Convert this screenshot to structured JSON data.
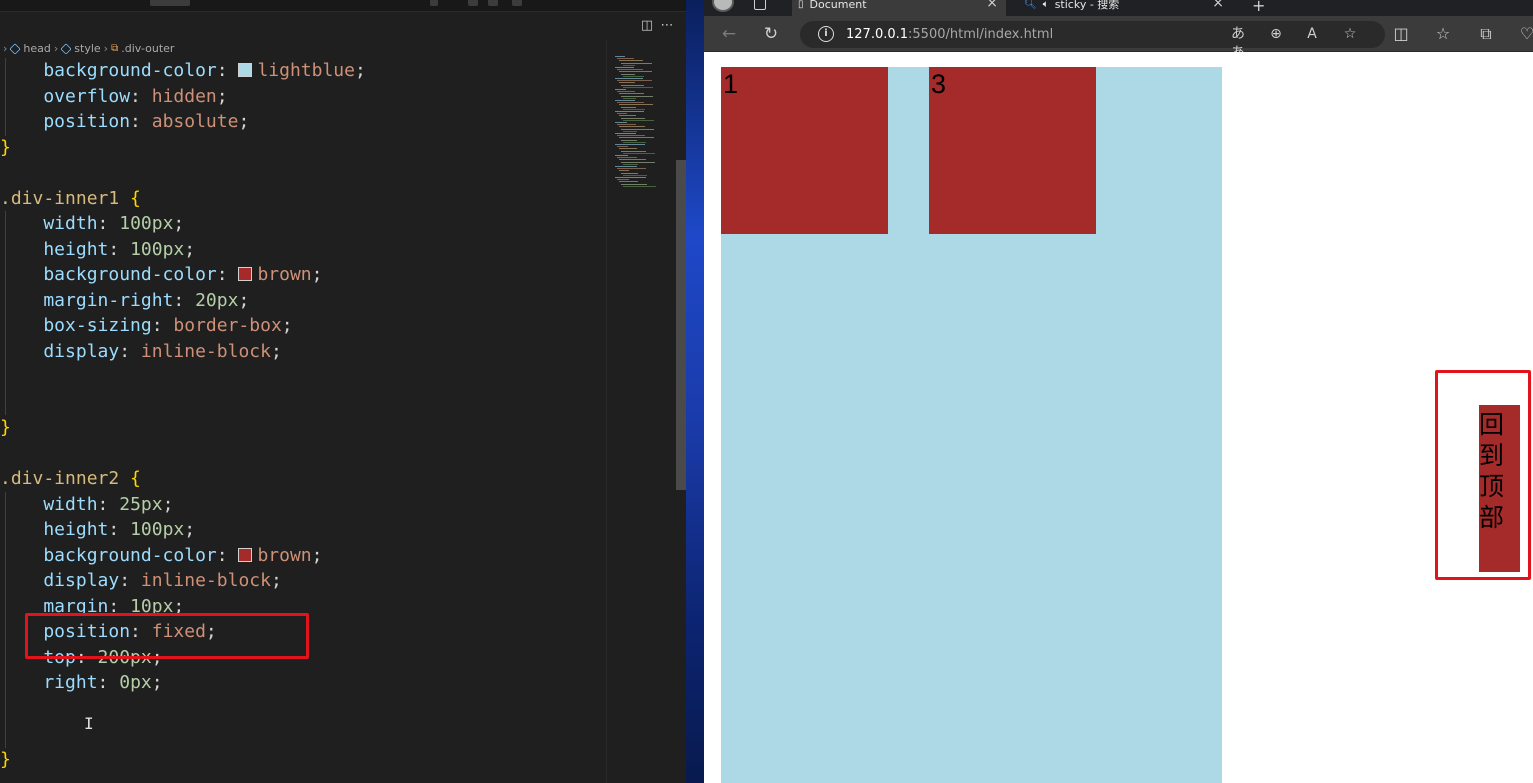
{
  "editor": {
    "breadcrumb": [
      "head",
      "style",
      ".div-outer"
    ],
    "lines": [
      {
        "row": 0,
        "tokens": [
          {
            "c": "prop",
            "t": "    background-color"
          },
          {
            "c": "punc",
            "t": ": "
          },
          {
            "c": "swatch",
            "color": "#add8e6"
          },
          {
            "c": "val",
            "t": "lightblue"
          },
          {
            "c": "punc",
            "t": ";"
          }
        ]
      },
      {
        "row": 1,
        "tokens": [
          {
            "c": "prop",
            "t": "    overflow"
          },
          {
            "c": "punc",
            "t": ": "
          },
          {
            "c": "val",
            "t": "hidden"
          },
          {
            "c": "punc",
            "t": ";"
          }
        ]
      },
      {
        "row": 2,
        "tokens": [
          {
            "c": "prop",
            "t": "    position"
          },
          {
            "c": "punc",
            "t": ": "
          },
          {
            "c": "val",
            "t": "absolute"
          },
          {
            "c": "punc",
            "t": ";"
          }
        ]
      },
      {
        "row": 3,
        "tokens": [
          {
            "c": "brace",
            "t": "}"
          }
        ]
      },
      {
        "row": 4,
        "tokens": []
      },
      {
        "row": 5,
        "tokens": [
          {
            "c": "sel",
            "t": ".div-inner1 "
          },
          {
            "c": "brace",
            "t": "{"
          }
        ]
      },
      {
        "row": 6,
        "tokens": [
          {
            "c": "prop",
            "t": "    width"
          },
          {
            "c": "punc",
            "t": ": "
          },
          {
            "c": "num",
            "t": "100px"
          },
          {
            "c": "punc",
            "t": ";"
          }
        ]
      },
      {
        "row": 7,
        "tokens": [
          {
            "c": "prop",
            "t": "    height"
          },
          {
            "c": "punc",
            "t": ": "
          },
          {
            "c": "num",
            "t": "100px"
          },
          {
            "c": "punc",
            "t": ";"
          }
        ]
      },
      {
        "row": 8,
        "tokens": [
          {
            "c": "prop",
            "t": "    background-color"
          },
          {
            "c": "punc",
            "t": ": "
          },
          {
            "c": "swatch",
            "color": "#a52a2a"
          },
          {
            "c": "val",
            "t": "brown"
          },
          {
            "c": "punc",
            "t": ";"
          }
        ]
      },
      {
        "row": 9,
        "tokens": [
          {
            "c": "prop",
            "t": "    margin-right"
          },
          {
            "c": "punc",
            "t": ": "
          },
          {
            "c": "num",
            "t": "20px"
          },
          {
            "c": "punc",
            "t": ";"
          }
        ]
      },
      {
        "row": 10,
        "tokens": [
          {
            "c": "prop",
            "t": "    box-sizing"
          },
          {
            "c": "punc",
            "t": ": "
          },
          {
            "c": "val",
            "t": "border-box"
          },
          {
            "c": "punc",
            "t": ";"
          }
        ]
      },
      {
        "row": 11,
        "tokens": [
          {
            "c": "prop",
            "t": "    display"
          },
          {
            "c": "punc",
            "t": ": "
          },
          {
            "c": "val",
            "t": "inline-block"
          },
          {
            "c": "punc",
            "t": ";"
          }
        ]
      },
      {
        "row": 12,
        "tokens": []
      },
      {
        "row": 13,
        "tokens": []
      },
      {
        "row": 14,
        "tokens": [
          {
            "c": "brace",
            "t": "}"
          }
        ]
      },
      {
        "row": 15,
        "tokens": []
      },
      {
        "row": 16,
        "tokens": [
          {
            "c": "sel",
            "t": ".div-inner2 "
          },
          {
            "c": "brace",
            "t": "{"
          }
        ]
      },
      {
        "row": 17,
        "tokens": [
          {
            "c": "prop",
            "t": "    width"
          },
          {
            "c": "punc",
            "t": ": "
          },
          {
            "c": "num",
            "t": "25px"
          },
          {
            "c": "punc",
            "t": ";"
          }
        ]
      },
      {
        "row": 18,
        "tokens": [
          {
            "c": "prop",
            "t": "    height"
          },
          {
            "c": "punc",
            "t": ": "
          },
          {
            "c": "num",
            "t": "100px"
          },
          {
            "c": "punc",
            "t": ";"
          }
        ]
      },
      {
        "row": 19,
        "tokens": [
          {
            "c": "prop",
            "t": "    background-color"
          },
          {
            "c": "punc",
            "t": ": "
          },
          {
            "c": "swatch",
            "color": "#a52a2a"
          },
          {
            "c": "val",
            "t": "brown"
          },
          {
            "c": "punc",
            "t": ";"
          }
        ]
      },
      {
        "row": 20,
        "tokens": [
          {
            "c": "prop",
            "t": "    display"
          },
          {
            "c": "punc",
            "t": ": "
          },
          {
            "c": "val",
            "t": "inline-block"
          },
          {
            "c": "punc",
            "t": ";"
          }
        ]
      },
      {
        "row": 21,
        "tokens": [
          {
            "c": "prop",
            "t": "    margin"
          },
          {
            "c": "punc",
            "t": ": "
          },
          {
            "c": "num",
            "t": "10px"
          },
          {
            "c": "punc",
            "t": ";"
          }
        ]
      },
      {
        "row": 22,
        "tokens": [
          {
            "c": "prop",
            "t": "    position"
          },
          {
            "c": "punc",
            "t": ": "
          },
          {
            "c": "val",
            "t": "fixed"
          },
          {
            "c": "punc",
            "t": ";"
          }
        ]
      },
      {
        "row": 23,
        "tokens": [
          {
            "c": "prop",
            "t": "    top"
          },
          {
            "c": "punc",
            "t": ": "
          },
          {
            "c": "num",
            "t": "200px"
          },
          {
            "c": "punc",
            "t": ";"
          }
        ]
      },
      {
        "row": 24,
        "tokens": [
          {
            "c": "prop",
            "t": "    right"
          },
          {
            "c": "punc",
            "t": ": "
          },
          {
            "c": "num",
            "t": "0px"
          },
          {
            "c": "punc",
            "t": ";"
          }
        ]
      },
      {
        "row": 25,
        "tokens": []
      },
      {
        "row": 26,
        "tokens": []
      },
      {
        "row": 27,
        "tokens": [
          {
            "c": "brace",
            "t": "}"
          }
        ]
      }
    ]
  },
  "browser": {
    "tabs": [
      {
        "title": "Document",
        "active": true
      },
      {
        "title": "sticky - 搜索",
        "active": false
      }
    ],
    "url_host": "127.0.0.1",
    "url_rest": ":5500/html/index.html",
    "page": {
      "box1_label": "1",
      "box2_label": "3",
      "fixed_button_label": "回到顶部"
    }
  },
  "colors": {
    "lightblue": "#add8e6",
    "brown": "#a52a2a",
    "highlight_red": "#e3131c"
  }
}
